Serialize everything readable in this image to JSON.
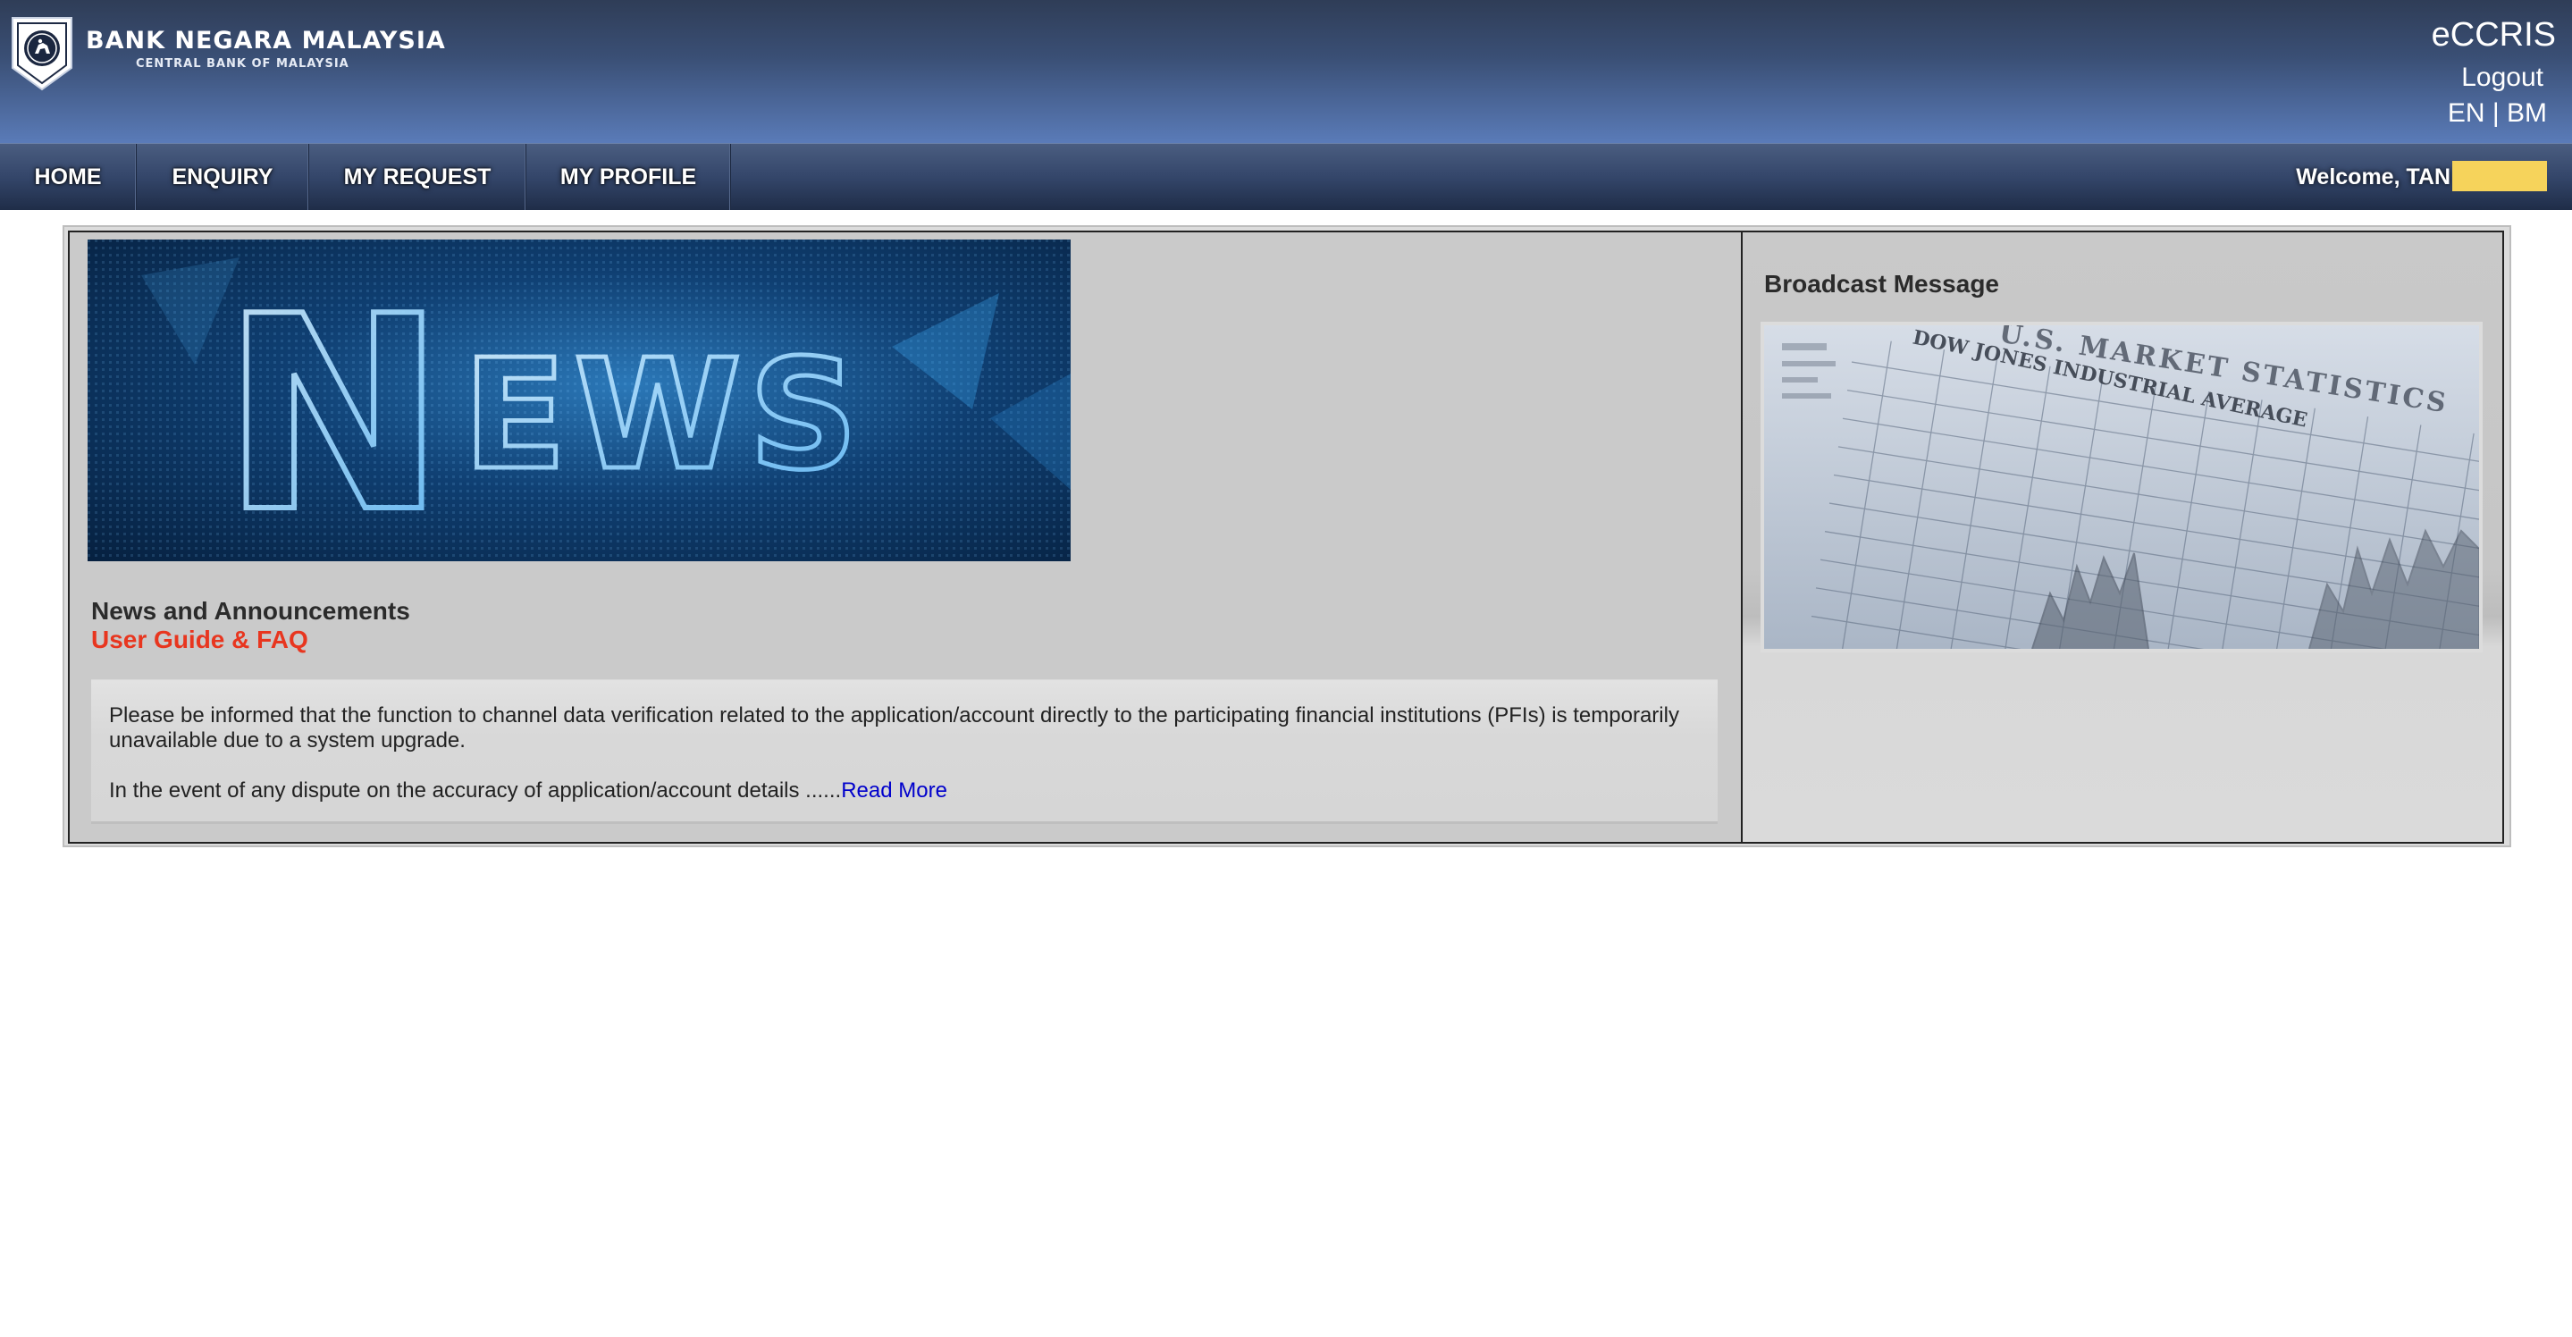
{
  "header": {
    "bank_name": "BANK NEGARA MALAYSIA",
    "bank_subtitle": "CENTRAL BANK OF MALAYSIA",
    "app_name": "eCCRIS",
    "logout_label": "Logout",
    "lang_en": "EN",
    "lang_separator": " | ",
    "lang_bm": "BM"
  },
  "nav": {
    "items": [
      {
        "label": "HOME"
      },
      {
        "label": "ENQUIRY"
      },
      {
        "label": "MY REQUEST"
      },
      {
        "label": "MY PROFILE"
      }
    ],
    "welcome": "Welcome, TAN"
  },
  "main": {
    "banner_text": "NEWS",
    "news_title": "News and Announcements",
    "guide_link": "User Guide & FAQ",
    "announcement_p1": "Please be informed that the function to channel data verification related to the application/account directly to the participating financial institutions (PFIs) is temporarily unavailable due to a system upgrade.",
    "announcement_p2": "In the event of any dispute on the accuracy of application/account details ......",
    "read_more": "Read More"
  },
  "sidebar": {
    "broadcast_title": "Broadcast Message",
    "image_text_1": "U.S. MARKET STATISTICS",
    "image_text_2": "DOW JONES INDUSTRIAL AVERAGE"
  },
  "colors": {
    "header_top": "#2f3d57",
    "header_bottom": "#5a7bb8",
    "nav_bg": "#34466a",
    "guide_link": "#e8361f",
    "read_more": "#0000cc",
    "username_mask": "#f6d35b"
  }
}
